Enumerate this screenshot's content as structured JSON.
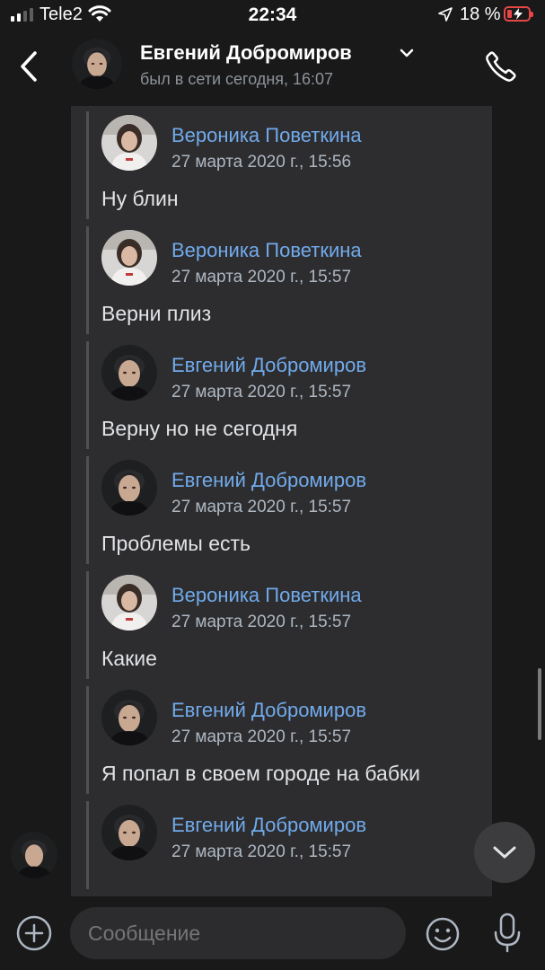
{
  "status_bar": {
    "carrier": "Tele2",
    "time": "22:34",
    "battery": "18 %"
  },
  "header": {
    "name": "Евгений Добромиров",
    "status": "был в сети сегодня, 16:07"
  },
  "messages": [
    {
      "author": "Вероника Поветкина",
      "date": "27 марта 2020 г., 15:56",
      "text": "Ну блин",
      "avatar": "female"
    },
    {
      "author": "Вероника Поветкина",
      "date": "27 марта 2020 г., 15:57",
      "text": "Верни плиз",
      "avatar": "female"
    },
    {
      "author": "Евгений Добромиров",
      "date": "27 марта 2020 г., 15:57",
      "text": "Верну но не сегодня",
      "avatar": "male"
    },
    {
      "author": "Евгений Добромиров",
      "date": "27 марта 2020 г., 15:57",
      "text": "Проблемы есть",
      "avatar": "male"
    },
    {
      "author": "Вероника Поветкина",
      "date": "27 марта 2020 г., 15:57",
      "text": "Какие",
      "avatar": "female"
    },
    {
      "author": "Евгений Добромиров",
      "date": "27 марта 2020 г., 15:57",
      "text": "Я попал в своем городе на бабки",
      "avatar": "male"
    },
    {
      "author": "Евгений Добромиров",
      "date": "27 марта 2020 г., 15:57",
      "text": "",
      "avatar": "male"
    }
  ],
  "composer": {
    "placeholder": "Сообщение"
  },
  "colors": {
    "background": "#19191a",
    "card": "#2d2d2f",
    "author_link": "#71aaeb",
    "battery_low": "#e64646"
  },
  "icons": [
    "back-icon",
    "chevron-down-icon",
    "phone-icon",
    "plus-icon",
    "smile-icon",
    "mic-icon",
    "arrow-down-icon"
  ]
}
